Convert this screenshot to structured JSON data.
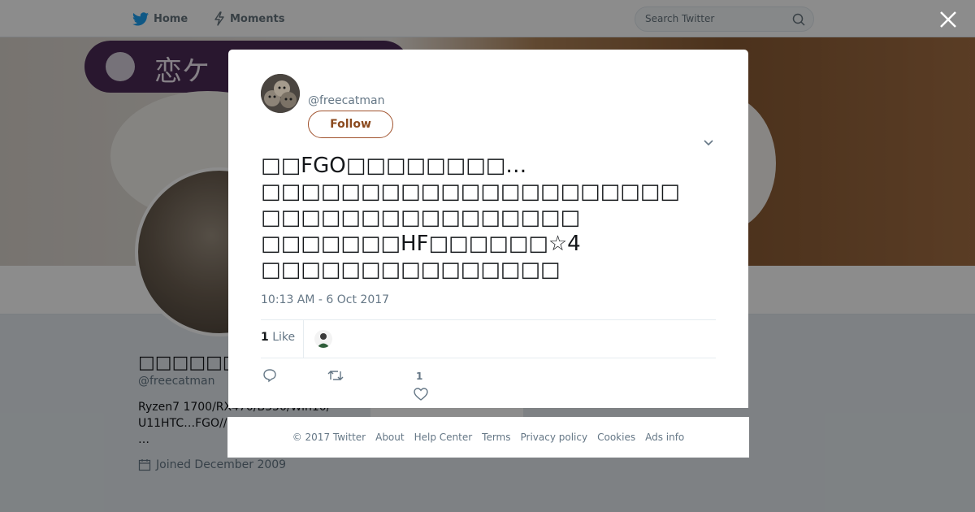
{
  "nav": {
    "home_label": "Home",
    "moments_label": "Moments",
    "search_placeholder": "Search Twitter"
  },
  "banner": {
    "tag_text": "恋ケ"
  },
  "profile": {
    "display_name": "□□□□□□□",
    "handle": "@freecatman",
    "bio": "Ryzen7 1700/RX470/B350/Win10/ U11HTC…FGO//",
    "bio_more": "…",
    "joined": "Joined December 2009"
  },
  "tweet": {
    "handle": "@freecatman",
    "follow_label": "Follow",
    "text": "□□FGO□□□□□□□□…\n□□□□□□□□□□□□□□□□□□□□□\n□□□□□□□□□□□□□□□□\n□□□□□□□HF□□□□□□☆4\n□□□□□□□□□□□□□□□",
    "timestamp": "10:13 AM - 6 Oct 2017",
    "like_count": "1",
    "like_label": "Like",
    "action_like_count": "1"
  },
  "footer": {
    "links": [
      "© 2017 Twitter",
      "About",
      "Help Center",
      "Terms",
      "Privacy policy",
      "Cookies",
      "Ads info"
    ]
  },
  "colors": {
    "follow_border": "#a0522d",
    "follow_text": "#8b4a1e",
    "twitter_blue": "#1da1f2",
    "banner_tag": "#4b2a57"
  },
  "icons": {
    "home": "twitter-bird-icon",
    "moments": "lightning-icon",
    "search": "search-icon",
    "close": "close-icon",
    "chevron": "chevron-down-icon",
    "reply": "reply-icon",
    "retweet": "retweet-icon",
    "like": "heart-icon",
    "calendar": "calendar-icon"
  }
}
